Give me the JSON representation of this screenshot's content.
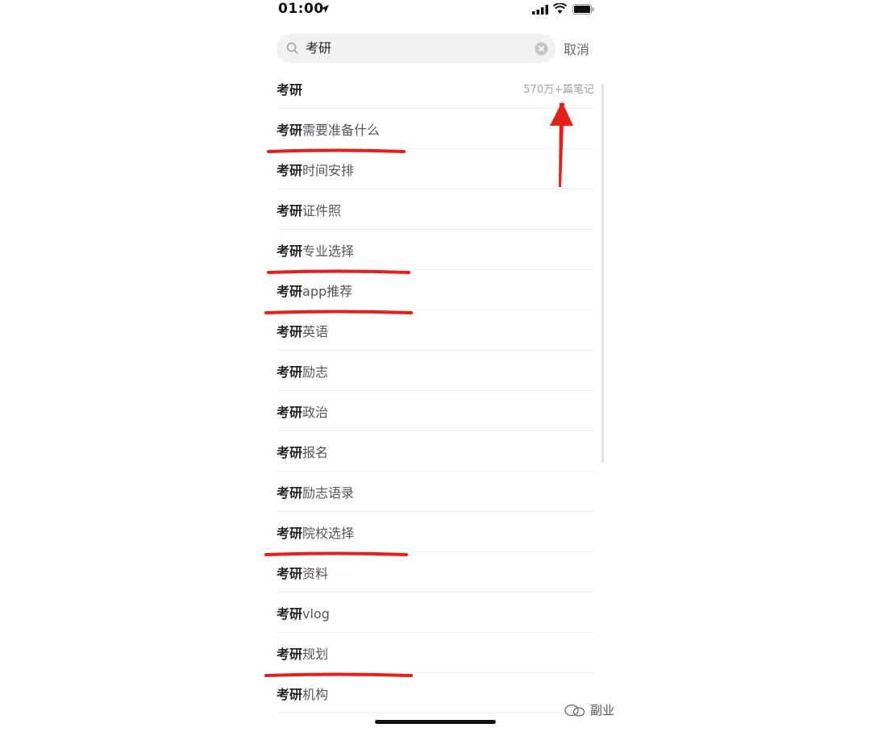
{
  "status_bar": {
    "time": "01:00"
  },
  "search": {
    "query": "考研",
    "cancel_label": "取消"
  },
  "suggestions": [
    {
      "keyword": "考研",
      "suffix": "",
      "count": "570万+篇笔记"
    },
    {
      "keyword": "考研",
      "suffix": "需要准备什么",
      "highlighted": true
    },
    {
      "keyword": "考研",
      "suffix": "时间安排"
    },
    {
      "keyword": "考研",
      "suffix": "证件照"
    },
    {
      "keyword": "考研",
      "suffix": "专业选择",
      "highlighted": true
    },
    {
      "keyword": "考研",
      "suffix": "app推荐",
      "highlighted": true
    },
    {
      "keyword": "考研",
      "suffix": "英语"
    },
    {
      "keyword": "考研",
      "suffix": "励志"
    },
    {
      "keyword": "考研",
      "suffix": "政治"
    },
    {
      "keyword": "考研",
      "suffix": "报名"
    },
    {
      "keyword": "考研",
      "suffix": "励志语录"
    },
    {
      "keyword": "考研",
      "suffix": "院校选择",
      "highlighted": true
    },
    {
      "keyword": "考研",
      "suffix": "资料"
    },
    {
      "keyword": "考研",
      "suffix": "vlog"
    },
    {
      "keyword": "考研",
      "suffix": "规划",
      "highlighted": true
    },
    {
      "keyword": "考研",
      "suffix": "机构"
    }
  ],
  "watermark": {
    "label": "副业"
  },
  "colors": {
    "annotation_red": "#e3201b",
    "keyword": "#222222",
    "count_gray": "#a0a0a0",
    "search_bg": "#f1f1f1"
  },
  "icons": [
    "location-arrow-icon",
    "signal-icon",
    "wifi-icon",
    "battery-icon",
    "search-icon",
    "clear-icon",
    "wechat-watermark-icon"
  ]
}
